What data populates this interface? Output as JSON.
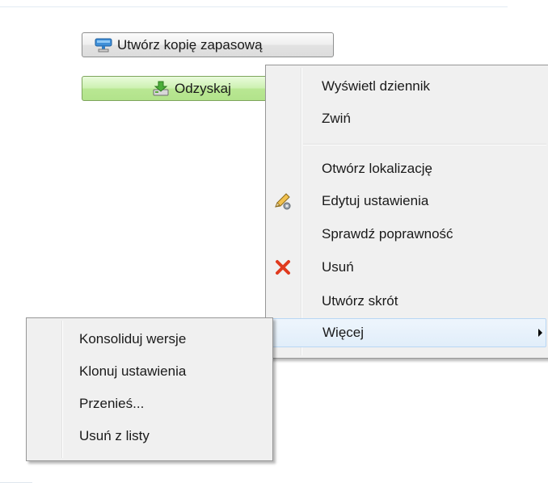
{
  "buttons": {
    "backup_label": "Utwórz kopię zapasową",
    "restore_label": "Odzyskaj"
  },
  "context_menu": {
    "items": [
      {
        "label": "Wyświetl dziennik"
      },
      {
        "label": "Zwiń"
      },
      {
        "label": "Otwórz lokalizację"
      },
      {
        "label": "Edytuj ustawienia",
        "icon": "pencil-gear-icon"
      },
      {
        "label": "Sprawdź poprawność"
      },
      {
        "label": "Usuń",
        "icon": "red-x-icon"
      },
      {
        "label": "Utwórz skrót"
      },
      {
        "label": "Więcej",
        "submenu": true
      }
    ]
  },
  "submenu": {
    "items": [
      {
        "label": "Konsoliduj wersje"
      },
      {
        "label": "Klonuj ustawienia"
      },
      {
        "label": "Przenieś..."
      },
      {
        "label": "Usuń z listy"
      }
    ]
  },
  "colors": {
    "menu_bg": "#f0f0f0",
    "restore_button": "#b9e793",
    "delete_icon": "#e03a1e"
  }
}
